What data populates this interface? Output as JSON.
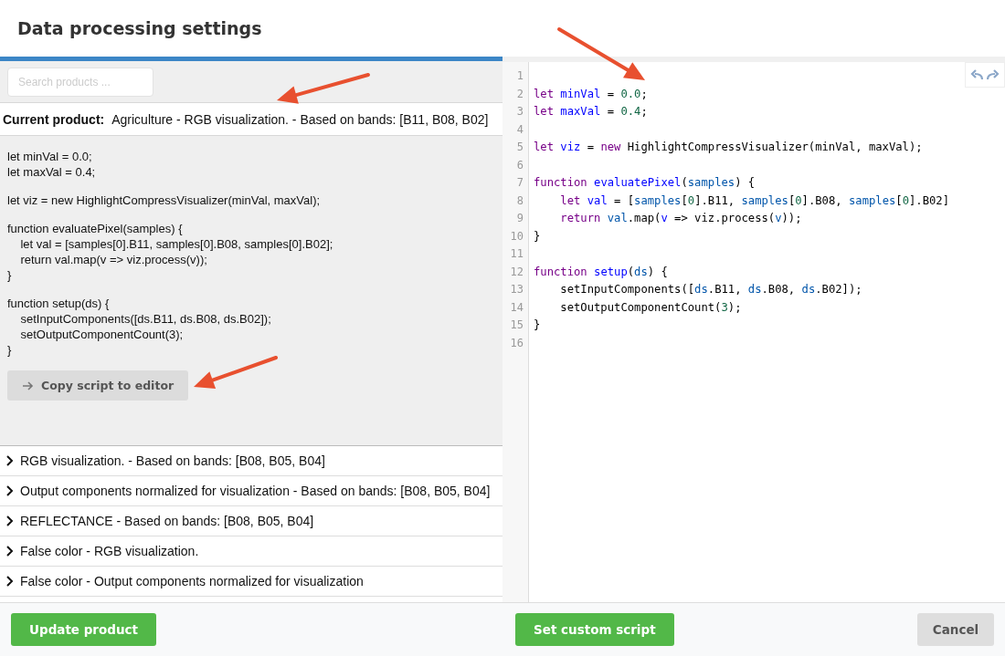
{
  "dialog": {
    "title": "Data processing settings"
  },
  "search": {
    "placeholder": "Search products ..."
  },
  "current_product": {
    "label": "Current product:",
    "value": "Agriculture - RGB visualization. - Based on bands: [B11, B08, B02]"
  },
  "script_blocks": [
    [
      "let minVal = 0.0;",
      "let maxVal = 0.4;"
    ],
    [
      "let viz = new HighlightCompressVisualizer(minVal, maxVal);"
    ],
    [
      "function evaluatePixel(samples) {",
      "    let val = [samples[0].B11, samples[0].B08, samples[0].B02];",
      "    return val.map(v => viz.process(v));",
      "}"
    ],
    [
      "function setup(ds) {",
      "    setInputComponents([ds.B11, ds.B08, ds.B02]);",
      "    setOutputComponentCount(3);",
      "}"
    ]
  ],
  "copy_button": {
    "label": "Copy script to editor"
  },
  "products": [
    {
      "label": "RGB visualization. - Based on bands: [B08, B05, B04]",
      "expanded": false
    },
    {
      "label": "Output components normalized for visualization - Based on bands: [B08, B05, B04]",
      "expanded": false
    },
    {
      "label": "REFLECTANCE - Based on bands: [B08, B05, B04]",
      "expanded": false
    },
    {
      "label": "False color - RGB visualization.",
      "expanded": false
    },
    {
      "label": "False color - Output components normalized for visualization",
      "expanded": false
    }
  ],
  "editor": {
    "lines": [
      {
        "number": "1"
      },
      {
        "number": "2",
        "tokens": [
          {
            "kind": "kw",
            "text": "let "
          },
          {
            "kind": "def",
            "text": "minVal"
          },
          {
            "kind": "plain",
            "text": " = "
          },
          {
            "kind": "num",
            "text": "0.0"
          },
          {
            "kind": "plain",
            "text": ";"
          }
        ]
      },
      {
        "number": "3",
        "tokens": [
          {
            "kind": "kw",
            "text": "let "
          },
          {
            "kind": "def",
            "text": "maxVal"
          },
          {
            "kind": "plain",
            "text": " = "
          },
          {
            "kind": "num",
            "text": "0.4"
          },
          {
            "kind": "plain",
            "text": ";"
          }
        ]
      },
      {
        "number": "4"
      },
      {
        "number": "5",
        "tokens": [
          {
            "kind": "kw",
            "text": "let "
          },
          {
            "kind": "def",
            "text": "viz"
          },
          {
            "kind": "plain",
            "text": " = "
          },
          {
            "kind": "kw",
            "text": "new"
          },
          {
            "kind": "plain",
            "text": " HighlightCompressVisualizer(minVal, maxVal);"
          }
        ]
      },
      {
        "number": "6"
      },
      {
        "number": "7",
        "tokens": [
          {
            "kind": "kw",
            "text": "function "
          },
          {
            "kind": "def",
            "text": "evaluatePixel"
          },
          {
            "kind": "plain",
            "text": "("
          },
          {
            "kind": "var",
            "text": "samples"
          },
          {
            "kind": "plain",
            "text": ") {"
          }
        ]
      },
      {
        "number": "8",
        "tokens": [
          {
            "kind": "kw",
            "text": "    let "
          },
          {
            "kind": "def",
            "text": "val"
          },
          {
            "kind": "plain",
            "text": " = ["
          },
          {
            "kind": "var",
            "text": "samples"
          },
          {
            "kind": "plain",
            "text": "["
          },
          {
            "kind": "num",
            "text": "0"
          },
          {
            "kind": "plain",
            "text": "].B11, "
          },
          {
            "kind": "var",
            "text": "samples"
          },
          {
            "kind": "plain",
            "text": "["
          },
          {
            "kind": "num",
            "text": "0"
          },
          {
            "kind": "plain",
            "text": "].B08, "
          },
          {
            "kind": "var",
            "text": "samples"
          },
          {
            "kind": "plain",
            "text": "["
          },
          {
            "kind": "num",
            "text": "0"
          },
          {
            "kind": "plain",
            "text": "].B02]"
          }
        ]
      },
      {
        "number": "9",
        "tokens": [
          {
            "kind": "kw",
            "text": "    return "
          },
          {
            "kind": "var",
            "text": "val"
          },
          {
            "kind": "plain",
            "text": ".map("
          },
          {
            "kind": "def",
            "text": "v"
          },
          {
            "kind": "plain",
            "text": " => viz.process("
          },
          {
            "kind": "var",
            "text": "v"
          },
          {
            "kind": "plain",
            "text": "));"
          }
        ]
      },
      {
        "number": "10",
        "tokens": [
          {
            "kind": "plain",
            "text": "}"
          }
        ]
      },
      {
        "number": "11"
      },
      {
        "number": "12",
        "tokens": [
          {
            "kind": "kw",
            "text": "function "
          },
          {
            "kind": "def",
            "text": "setup"
          },
          {
            "kind": "plain",
            "text": "("
          },
          {
            "kind": "var",
            "text": "ds"
          },
          {
            "kind": "plain",
            "text": ") {"
          }
        ]
      },
      {
        "number": "13",
        "tokens": [
          {
            "kind": "plain",
            "text": "    setInputComponents(["
          },
          {
            "kind": "var",
            "text": "ds"
          },
          {
            "kind": "plain",
            "text": ".B11, "
          },
          {
            "kind": "var",
            "text": "ds"
          },
          {
            "kind": "plain",
            "text": ".B08, "
          },
          {
            "kind": "var",
            "text": "ds"
          },
          {
            "kind": "plain",
            "text": ".B02]);"
          }
        ]
      },
      {
        "number": "14",
        "tokens": [
          {
            "kind": "plain",
            "text": "    setOutputComponentCount("
          },
          {
            "kind": "num",
            "text": "3"
          },
          {
            "kind": "plain",
            "text": ");"
          }
        ]
      },
      {
        "number": "15",
        "tokens": [
          {
            "kind": "plain",
            "text": "}"
          }
        ]
      },
      {
        "number": "16"
      }
    ]
  },
  "footer": {
    "update_button": "Update product",
    "custom_button": "Set custom script",
    "cancel_button": "Cancel"
  }
}
